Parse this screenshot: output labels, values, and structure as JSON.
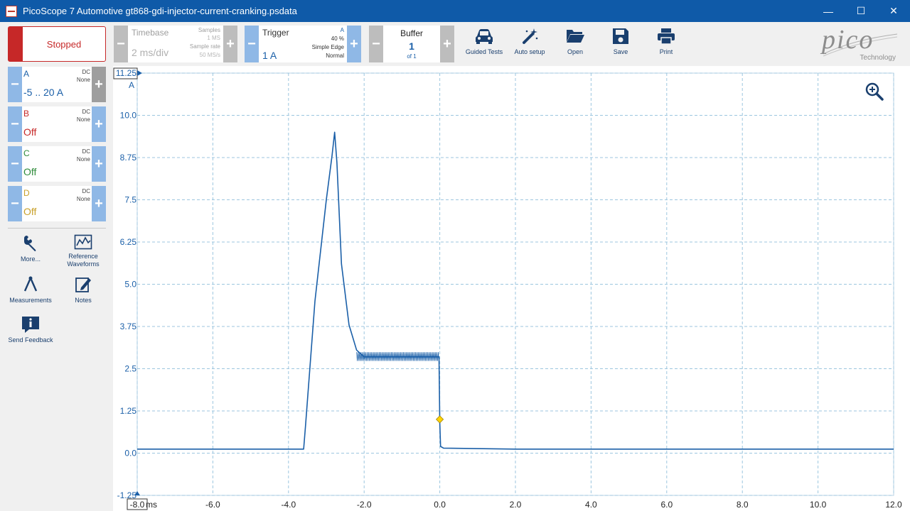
{
  "window": {
    "title": "PicoScope 7 Automotive gt868-gdi-injector-current-cranking.psdata",
    "minimize": "—",
    "maximize": "☐",
    "close": "✕"
  },
  "run": {
    "label": "Stopped"
  },
  "timebase": {
    "label": "Timebase",
    "value": "2 ms/div",
    "samples_label": "Samples",
    "samples_value": "1 MS",
    "rate_label": "Sample rate",
    "rate_value": "50 MS/s"
  },
  "trigger": {
    "label": "Trigger",
    "value": "1 A",
    "channel": "A",
    "position": "40 %",
    "type": "Simple Edge",
    "mode": "Normal"
  },
  "buffer": {
    "label": "Buffer",
    "value": "1",
    "of": "of 1"
  },
  "toolbar": {
    "guided_tests": "Guided Tests",
    "auto_setup": "Auto setup",
    "open": "Open",
    "save": "Save",
    "print": "Print"
  },
  "logo": {
    "word": "pico",
    "tech": "Technology"
  },
  "channels": [
    {
      "name": "A",
      "coupling": "DC",
      "filter": "None",
      "value": "-5 .. 20 A",
      "color": "#1a5fa8"
    },
    {
      "name": "B",
      "coupling": "DC",
      "filter": "None",
      "value": "Off",
      "color": "#c62828"
    },
    {
      "name": "C",
      "coupling": "DC",
      "filter": "None",
      "value": "Off",
      "color": "#2e8b3a"
    },
    {
      "name": "D",
      "coupling": "DC",
      "filter": "None",
      "value": "Off",
      "color": "#c8a02a"
    }
  ],
  "side": {
    "more": "More...",
    "reference_1": "Reference",
    "reference_2": "Waveforms",
    "measurements": "Measurements",
    "notes": "Notes",
    "feedback": "Send Feedback"
  },
  "chart_data": {
    "type": "line",
    "xunit": "ms",
    "yunit": "A",
    "xlim": [
      -8.0,
      12.0
    ],
    "ylim": [
      -1.25,
      11.25
    ],
    "xticks": [
      -8.0,
      -6.0,
      -4.0,
      -2.0,
      0.0,
      2.0,
      4.0,
      6.0,
      8.0,
      10.0,
      12.0
    ],
    "xtick_labels": [
      "-8.0",
      "-6.0",
      "-4.0",
      "-2.0",
      "0.0",
      "2.0",
      "4.0",
      "6.0",
      "8.0",
      "10.0",
      "12.0"
    ],
    "yticks": [
      -1.25,
      0.0,
      1.25,
      2.5,
      3.75,
      5.0,
      6.25,
      7.5,
      8.75,
      10.0,
      11.25
    ],
    "ytick_labels": [
      "-1.25",
      "0.0",
      "1.25",
      "2.5",
      "3.75",
      "5.0",
      "6.25",
      "7.5",
      "8.75",
      "10.0",
      "11.25"
    ],
    "grid": true,
    "trigger_point": {
      "x": 0.0,
      "y": 1.0
    },
    "series": [
      {
        "color": "#1a5fa8",
        "x": [
          -8.0,
          -3.6,
          -3.55,
          -3.3,
          -3.0,
          -2.85,
          -2.78,
          -2.72,
          -2.6,
          -2.4,
          -2.2,
          -2.0,
          -1.5,
          -1.0,
          -0.5,
          -0.02,
          0.0,
          0.02,
          0.1,
          2.0,
          6.0,
          12.0
        ],
        "y": [
          0.12,
          0.12,
          0.8,
          4.5,
          7.5,
          8.8,
          9.5,
          8.6,
          5.6,
          3.8,
          3.05,
          2.85,
          2.85,
          2.85,
          2.85,
          2.85,
          0.9,
          0.2,
          0.15,
          0.12,
          0.12,
          0.12
        ]
      }
    ]
  }
}
